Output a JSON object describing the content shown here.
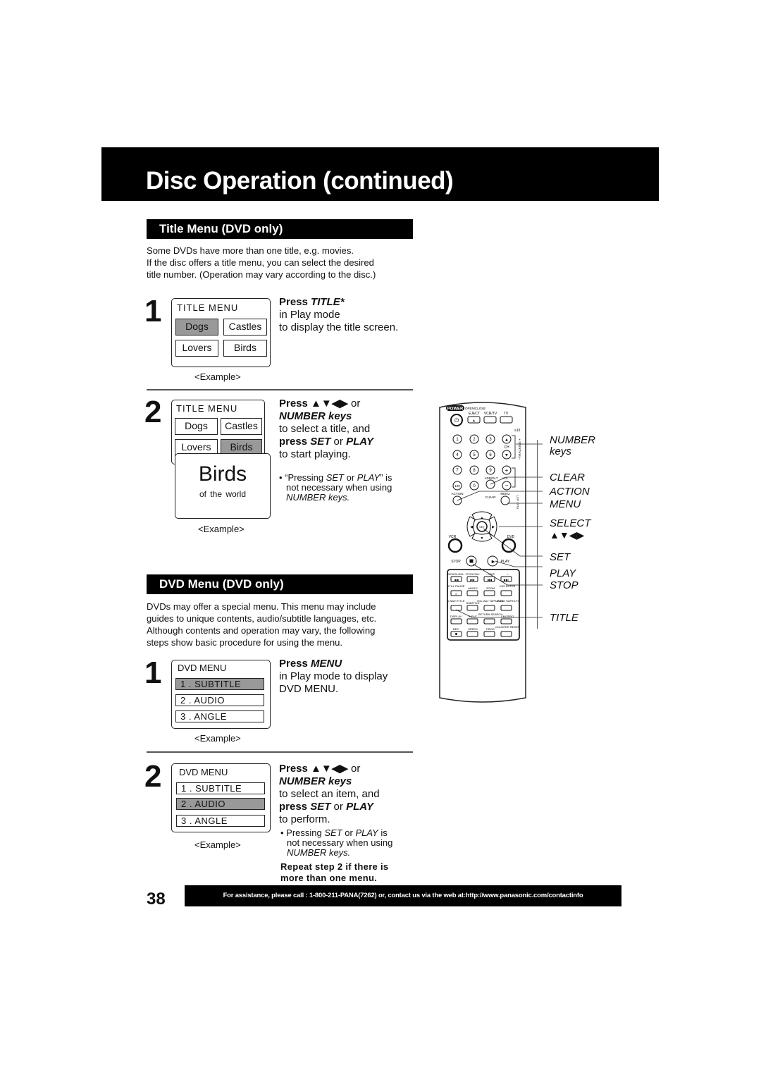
{
  "page": {
    "title": "Disc Operation (continued)",
    "page_number": "38",
    "footer": "For assistance, please call : 1-800-211-PANA(7262) or, contact us via the web at:http://www.panasonic.com/contactinfo"
  },
  "title_menu": {
    "heading": "Title Menu (DVD only)",
    "intro": [
      "Some DVDs have more than one title, e.g. movies.",
      "If the disc offers a title menu, you can select the desired",
      "title number. (Operation may vary according to the disc.)"
    ],
    "step1": {
      "num": "1",
      "screen_title": "TITLE MENU",
      "cells": [
        "Dogs",
        "Castles",
        "Lovers",
        "Birds"
      ],
      "selected": "Dogs",
      "example": "<Example>",
      "press": "Press ",
      "key": "TITLE*",
      "line2": "in Play mode",
      "line3": "to display the title screen."
    },
    "step2": {
      "num": "2",
      "screen_title": "TITLE MENU",
      "cells": [
        "Dogs",
        "Castles",
        "Lovers",
        "Birds"
      ],
      "selected": "Birds",
      "overlay_title": "Birds",
      "overlay_sub": "of the world",
      "example": "<Example>",
      "press": "Press ▲▼◀▶",
      "or": " or",
      "number_keys": "NUMBER keys",
      "line3": "to select a title, and",
      "press_set": "press ",
      "set": "SET",
      "or2": " or ",
      "play": "PLAY",
      "line5": "to start playing.",
      "note_1": "• “Pressing ",
      "note_set": "SET",
      "note_or": " or ",
      "note_play": "PLAY",
      "note_2": "” is",
      "note_3": "not necessary when using",
      "note_4": "NUMBER keys."
    }
  },
  "dvd_menu": {
    "heading": "DVD Menu (DVD only)",
    "intro": [
      "DVDs may offer a special menu. This menu may include",
      "guides to unique contents, audio/subtitle languages, etc.",
      "Although contents and operation may vary, the following",
      "steps show basic procedure for using the menu."
    ],
    "step1": {
      "num": "1",
      "screen_title": "DVD MENU",
      "items": [
        "1 . SUBTITLE",
        "2 . AUDIO",
        "3 . ANGLE"
      ],
      "selected": "1 . SUBTITLE",
      "example": "<Example>",
      "press": "Press ",
      "key": "MENU",
      "line2": "in Play mode to display",
      "line3": "DVD MENU."
    },
    "step2": {
      "num": "2",
      "screen_title": "DVD MENU",
      "items": [
        "1 . SUBTITLE",
        "2 . AUDIO",
        "3 . ANGLE"
      ],
      "selected": "2 . AUDIO",
      "example": "<Example>",
      "press": "Press ▲▼◀▶",
      "or": " or",
      "number_keys": "NUMBER keys",
      "line3": "to select an item, and",
      "press_set": "press ",
      "set": "SET",
      "or2": " or ",
      "play": "PLAY",
      "line5": "to perform.",
      "note_1": "• Pressing ",
      "note_set": "SET",
      "note_or": " or ",
      "note_play": "PLAY",
      "note_2": " is",
      "note_3": "not necessary when using",
      "note_4": "NUMBER keys.",
      "repeat_1": "Repeat step 2 if there is",
      "repeat_2": "more than one menu."
    }
  },
  "remote": {
    "top_labels": {
      "power": "POWER",
      "open_close": "OPEN/CLOSE",
      "eject": "EJECT",
      "vcrtv": "VCR/TV",
      "tv": "TV",
      "ge10": "≥10",
      "ch": "CH",
      "tracking": "–TRACKING +"
    },
    "digits": [
      "1",
      "2",
      "3",
      "4",
      "5",
      "6",
      "7",
      "8",
      "9",
      "100",
      "0"
    ],
    "mid_labels": {
      "add_dlt": "ADD/DLT",
      "vol": "VOL",
      "action": "ACTION",
      "clear": "CLEAR",
      "menu": "MENU",
      "play_list": "PLAY LIST",
      "set": "SET",
      "vcr": "VCR",
      "dvd": "DVD",
      "stop": "STOP",
      "play": "PLAY"
    },
    "lower_rows": [
      [
        "REW/SLOW–",
        "FF/SLOW+",
        "– SKIP",
        "+"
      ],
      [
        "STILL PAUSE",
        "ANGLE",
        "ZOOM",
        "VSS ENTER"
      ],
      [
        "D.NAVI TITLE",
        "SUBTITLE",
        "VOL.ADJ TAPE POS.",
        "AUDIO SAP/Hi-Fi"
      ],
      [
        "DISPLAY",
        "INPUT",
        "RETURN SEARCH",
        "CM/ZERO"
      ],
      [
        "REC",
        "SPEED",
        "PROG",
        "COUNTER RESET"
      ]
    ],
    "callouts": [
      {
        "label": "NUMBER",
        "label2": "keys"
      },
      {
        "label": "CLEAR"
      },
      {
        "label": "ACTION"
      },
      {
        "label": "MENU"
      },
      {
        "label": "SELECT",
        "label2": "▲▼◀▶"
      },
      {
        "label": "SET"
      },
      {
        "label": "PLAY"
      },
      {
        "label": "STOP"
      },
      {
        "label": "TITLE"
      }
    ]
  }
}
